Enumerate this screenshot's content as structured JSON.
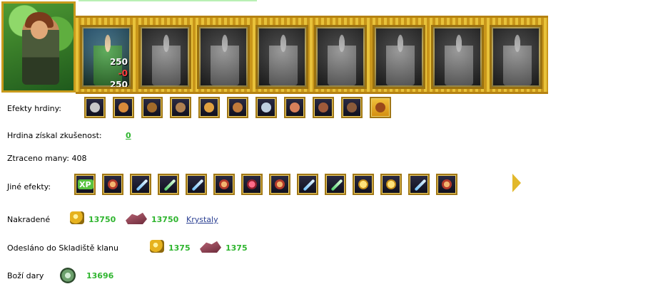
{
  "units": {
    "first_counts": {
      "top": "250",
      "mid": "-0",
      "bottom": "250"
    }
  },
  "labels": {
    "hero_effects": "Efekty hrdiny:",
    "experience": "Hrdina získal zkušenost:",
    "mana_lost": "Ztraceno many: 408",
    "other_effects": "Jiné efekty:",
    "stolen": "Nakradené",
    "sent_to_clan": "Odesláno do Skladiště klanu",
    "god_gifts": "Boží dary"
  },
  "values": {
    "experience": "0",
    "stolen_gold": "13750",
    "stolen_ore": "13750",
    "crystals_link": "Krystaly",
    "sent_gold": "1375",
    "sent_ore": "1375",
    "god_gifts": "13696"
  },
  "icons": {
    "xp_badge_text": "XP"
  }
}
